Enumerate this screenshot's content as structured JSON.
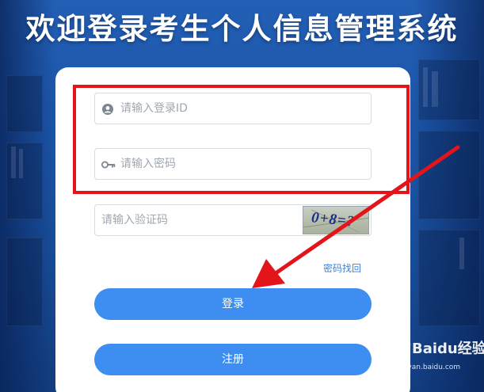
{
  "page": {
    "title": "欢迎登录考生个人信息管理系统"
  },
  "login_form": {
    "id_input": {
      "placeholder": "请输入登录ID",
      "icon": "user-icon"
    },
    "password_input": {
      "placeholder": "请输入密码",
      "icon": "key-icon"
    },
    "captcha_input": {
      "placeholder": "请输入验证码"
    },
    "captcha_image": {
      "text": "0+8=?"
    },
    "forgot_password_link": "密码找回",
    "login_button": "登录",
    "register_button": "注册"
  },
  "annotation": {
    "highlight_color": "#e4141b"
  },
  "watermark": {
    "logo": "Baidu经验",
    "url": "jingyan.baidu.com"
  },
  "colors": {
    "background": "#1c4f9f",
    "button": "#3d8ef0",
    "link": "#3f82d6"
  }
}
